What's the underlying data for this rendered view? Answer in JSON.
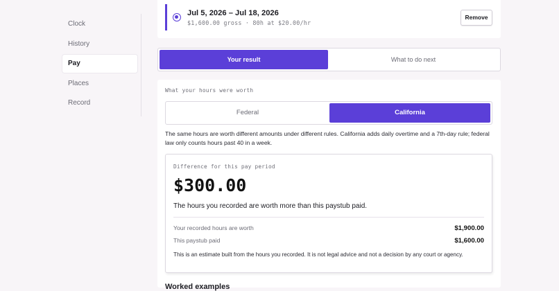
{
  "sidebar": {
    "items": [
      {
        "label": "Clock"
      },
      {
        "label": "History"
      },
      {
        "label": "Pay"
      },
      {
        "label": "Places"
      },
      {
        "label": "Record"
      }
    ]
  },
  "pay_period": {
    "dates": "Jul 5, 2026 – Jul 18, 2026",
    "details": "$1,600.00 gross · 80h at $20.00/hr",
    "remove_label": "Remove"
  },
  "result_tabs": {
    "your_result": "Your result",
    "what_next": "What to do next"
  },
  "worth": {
    "section_label": "What your hours were worth",
    "federal_label": "Federal",
    "california_label": "California",
    "explainer": "The same hours are worth different amounts under different rules. California adds daily overtime and a 7th-day rule; federal law only counts hours past 40 in a week."
  },
  "difference": {
    "label": "Difference for this pay period",
    "amount": "$300.00",
    "note": "The hours you recorded are worth more than this paystub paid.",
    "recorded_label": "Your recorded hours are worth",
    "recorded_value": "$1,900.00",
    "paid_label": "This paystub paid",
    "paid_value": "$1,600.00",
    "disclaimer": "This is an estimate built from the hours you recorded. It is not legal advice and not a decision by any court or agency."
  },
  "next_section": {
    "heading": "Worked examples"
  },
  "colors": {
    "accent": "#5b3fd8",
    "background": "#f8f5f8"
  }
}
